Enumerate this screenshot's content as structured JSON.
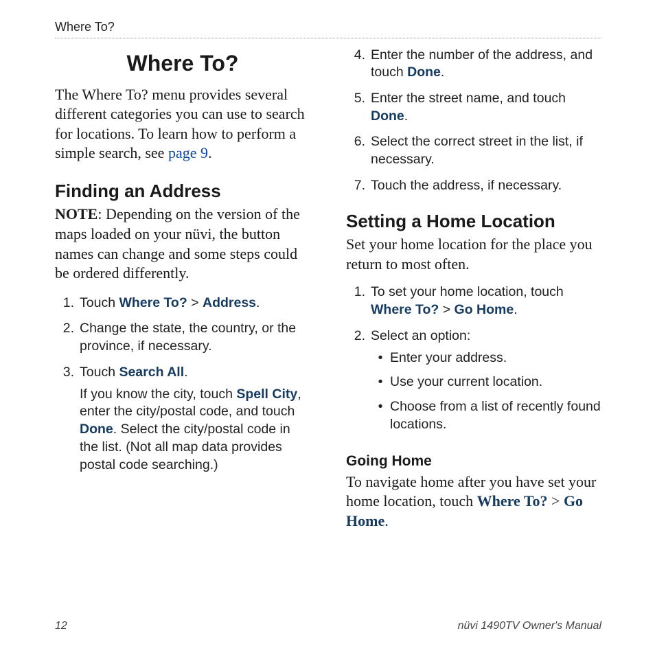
{
  "breadcrumb": "Where To?",
  "h1": "Where To?",
  "intro_1": "The Where To? menu provides several different categories you can use to search for locations. To learn how to perform a simple search, see ",
  "intro_link": "page 9",
  "intro_2": ".",
  "h2_find": "Finding an Address",
  "note_label": "NOTE",
  "note_text": ": Depending on the version of the maps loaded on your nüvi, the button names can change and some steps could be ordered differently.",
  "s1_a": "Touch ",
  "s1_b": "Where To?",
  "s1_c": " > ",
  "s1_d": "Address",
  "s1_e": ".",
  "s2": "Change the state, the country, or the province, if necessary.",
  "s3_a": "Touch ",
  "s3_b": "Search All",
  "s3_c": ".",
  "s3_sub_a": "If you know the city, touch ",
  "s3_sub_b": "Spell City",
  "s3_sub_c": ", enter the city/postal code, and touch ",
  "s3_sub_d": "Done",
  "s3_sub_e": ". Select the city/postal code in the list. (Not all map data provides postal code searching.)",
  "s4_a": "Enter the number of the address, and touch ",
  "s4_b": "Done",
  "s4_c": ".",
  "s5_a": "Enter the street name, and touch ",
  "s5_b": "Done",
  "s5_c": ".",
  "s6": "Select the correct street in the list, if necessary.",
  "s7": "Touch the address, if necessary.",
  "h2_home": "Setting a Home Location",
  "home_intro": "Set your home location for the place you return to most often.",
  "h1s_a": "To set your home location, touch ",
  "h1s_b": "Where To?",
  "h1s_c": " > ",
  "h1s_d": "Go Home",
  "h1s_e": ".",
  "h2s": "Select an option:",
  "b1": "Enter your address.",
  "b2": "Use your current location.",
  "b3": "Choose from a list of recently found locations.",
  "h3_going": "Going Home",
  "going_a": "To navigate home after you have set your home location, touch ",
  "going_b": "Where To?",
  "going_c": " > ",
  "going_d": "Go Home",
  "going_e": ".",
  "n": {
    "1": "1.",
    "2": "2.",
    "3": "3.",
    "4": "4.",
    "5": "5.",
    "6": "6.",
    "7": "7."
  },
  "bullet": "•",
  "page_num": "12",
  "manual": "nüvi 1490TV Owner's Manual"
}
